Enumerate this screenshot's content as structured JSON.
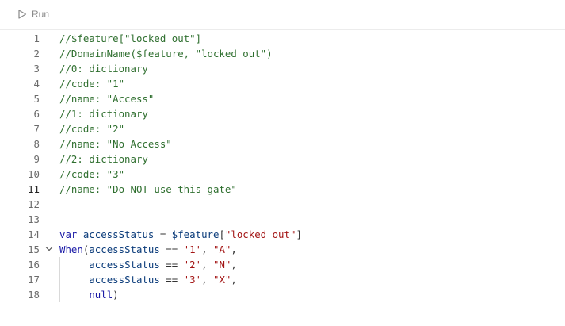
{
  "toolbar": {
    "run_label": "Run",
    "run_icon": "play-icon"
  },
  "editor": {
    "active_line": 11,
    "lines": [
      {
        "n": "1",
        "tokens": [
          {
            "t": "//$feature[\"locked_out\"]",
            "c": "cmt"
          }
        ]
      },
      {
        "n": "2",
        "tokens": [
          {
            "t": "//DomainName($feature, \"locked_out\")",
            "c": "cmt"
          }
        ]
      },
      {
        "n": "3",
        "tokens": [
          {
            "t": "//0: dictionary",
            "c": "cmt"
          }
        ]
      },
      {
        "n": "4",
        "tokens": [
          {
            "t": "//code: \"1\"",
            "c": "cmt"
          }
        ]
      },
      {
        "n": "5",
        "tokens": [
          {
            "t": "//name: \"Access\"",
            "c": "cmt"
          }
        ]
      },
      {
        "n": "6",
        "tokens": [
          {
            "t": "//1: dictionary",
            "c": "cmt"
          }
        ]
      },
      {
        "n": "7",
        "tokens": [
          {
            "t": "//code: \"2\"",
            "c": "cmt"
          }
        ]
      },
      {
        "n": "8",
        "tokens": [
          {
            "t": "//name: \"No Access\"",
            "c": "cmt"
          }
        ]
      },
      {
        "n": "9",
        "tokens": [
          {
            "t": "//2: dictionary",
            "c": "cmt"
          }
        ]
      },
      {
        "n": "10",
        "tokens": [
          {
            "t": "//code: \"3\"",
            "c": "cmt"
          }
        ]
      },
      {
        "n": "11",
        "tokens": [
          {
            "t": "//name: \"Do NOT use this gate\"",
            "c": "cmt"
          }
        ]
      },
      {
        "n": "12",
        "tokens": []
      },
      {
        "n": "13",
        "tokens": []
      },
      {
        "n": "14",
        "tokens": [
          {
            "t": "var ",
            "c": "kw"
          },
          {
            "t": "accessStatus",
            "c": "id"
          },
          {
            "t": " = ",
            "c": "op"
          },
          {
            "t": "$feature",
            "c": "id"
          },
          {
            "t": "[",
            "c": "op"
          },
          {
            "t": "\"locked_out\"",
            "c": "str"
          },
          {
            "t": "]",
            "c": "op"
          }
        ]
      },
      {
        "n": "15",
        "fold": true,
        "tokens": [
          {
            "t": "When",
            "c": "kw"
          },
          {
            "t": "(",
            "c": "op"
          },
          {
            "t": "accessStatus",
            "c": "id"
          },
          {
            "t": " == ",
            "c": "op"
          },
          {
            "t": "'1'",
            "c": "str"
          },
          {
            "t": ", ",
            "c": "op"
          },
          {
            "t": "\"A\"",
            "c": "str"
          },
          {
            "t": ",",
            "c": "op"
          }
        ]
      },
      {
        "n": "16",
        "tokens": [
          {
            "t": "     ",
            "c": "op"
          },
          {
            "t": "accessStatus",
            "c": "id"
          },
          {
            "t": " == ",
            "c": "op"
          },
          {
            "t": "'2'",
            "c": "str"
          },
          {
            "t": ", ",
            "c": "op"
          },
          {
            "t": "\"N\"",
            "c": "str"
          },
          {
            "t": ",",
            "c": "op"
          }
        ]
      },
      {
        "n": "17",
        "tokens": [
          {
            "t": "     ",
            "c": "op"
          },
          {
            "t": "accessStatus",
            "c": "id"
          },
          {
            "t": " == ",
            "c": "op"
          },
          {
            "t": "'3'",
            "c": "str"
          },
          {
            "t": ", ",
            "c": "op"
          },
          {
            "t": "\"X\"",
            "c": "str"
          },
          {
            "t": ",",
            "c": "op"
          }
        ]
      },
      {
        "n": "18",
        "tokens": [
          {
            "t": "     ",
            "c": "op"
          },
          {
            "t": "null",
            "c": "kw"
          },
          {
            "t": ")",
            "c": "op"
          }
        ]
      }
    ]
  },
  "colors": {
    "comment": "#2f6f2f",
    "keyword": "#1a1aa6",
    "string": "#a31515",
    "identifier": "#0a3b7a"
  }
}
